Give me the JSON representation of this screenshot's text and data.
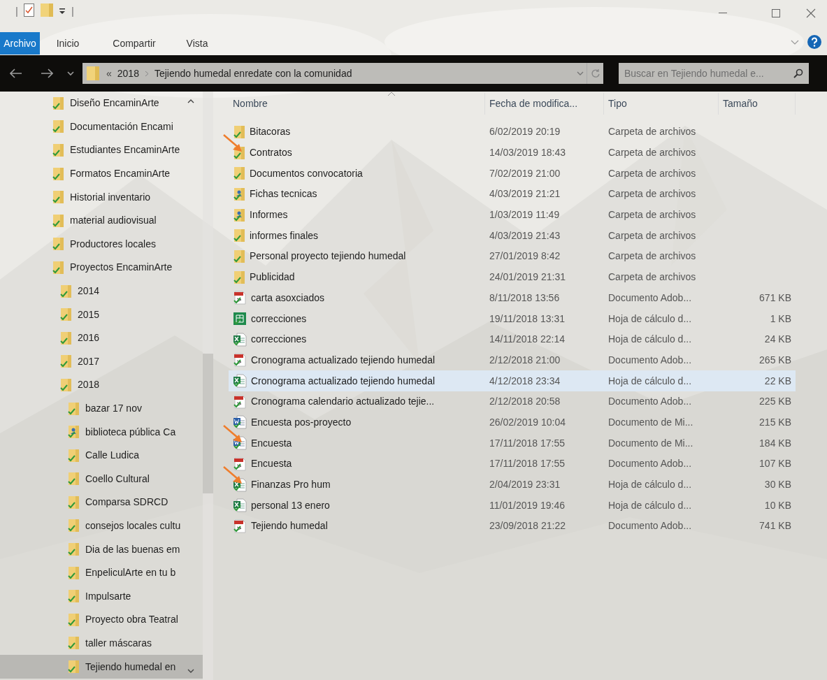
{
  "quick_access_toolbar": {
    "separator_left": "|",
    "separator_right": "|"
  },
  "ribbon_tabs": [
    {
      "label": "Archivo",
      "selected": true
    },
    {
      "label": "Inicio",
      "selected": false
    },
    {
      "label": "Compartir",
      "selected": false
    },
    {
      "label": "Vista",
      "selected": false
    }
  ],
  "address_bar": {
    "overflow": "«",
    "segments": [
      "2018",
      "Tejiendo humedal enredate con la comunidad"
    ]
  },
  "search": {
    "placeholder": "Buscar en Tejiendo humedal e..."
  },
  "sidebar": {
    "items": [
      {
        "label": "Diseño EncaminArte",
        "kind": "folder",
        "selected": false
      },
      {
        "label": "Documentación Encami",
        "kind": "folder",
        "selected": false
      },
      {
        "label": "Estudiantes EncaminArte",
        "kind": "folder",
        "selected": false
      },
      {
        "label": "Formatos EncaminArte",
        "kind": "folder",
        "selected": false
      },
      {
        "label": "Historial inventario",
        "kind": "folder",
        "selected": false
      },
      {
        "label": "material audiovisual",
        "kind": "folder",
        "selected": false
      },
      {
        "label": "Productores locales",
        "kind": "folder",
        "selected": false
      },
      {
        "label": "Proyectos EncaminArte",
        "kind": "folder",
        "selected": false,
        "children": [
          {
            "label": "2014",
            "kind": "folder",
            "selected": false
          },
          {
            "label": "2015",
            "kind": "folder",
            "selected": false
          },
          {
            "label": "2016",
            "kind": "folder",
            "selected": false
          },
          {
            "label": "2017",
            "kind": "folder",
            "selected": false
          },
          {
            "label": "2018",
            "kind": "folder",
            "selected": false,
            "children": [
              {
                "label": "bazar 17 nov",
                "kind": "folder",
                "selected": false
              },
              {
                "label": "biblioteca pública Ca",
                "kind": "shared-folder",
                "selected": false
              },
              {
                "label": "Calle Ludica",
                "kind": "folder",
                "selected": false
              },
              {
                "label": "Coello Cultural",
                "kind": "folder",
                "selected": false
              },
              {
                "label": "Comparsa SDRCD",
                "kind": "folder",
                "selected": false
              },
              {
                "label": "consejos locales cultu",
                "kind": "folder",
                "selected": false
              },
              {
                "label": "Dia de las buenas em",
                "kind": "folder",
                "selected": false
              },
              {
                "label": "EnpeliculArte en tu b",
                "kind": "folder",
                "selected": false
              },
              {
                "label": "Impulsarte",
                "kind": "folder",
                "selected": false
              },
              {
                "label": "Proyecto obra Teatral",
                "kind": "folder",
                "selected": false
              },
              {
                "label": "taller máscaras",
                "kind": "folder",
                "selected": false
              },
              {
                "label": "Tejiendo humedal en",
                "kind": "folder",
                "selected": true
              }
            ]
          }
        ]
      }
    ]
  },
  "table": {
    "columns": [
      "Nombre",
      "Fecha de modifica...",
      "Tipo",
      "Tamaño"
    ],
    "rows": [
      {
        "kind": "folder",
        "name": "Bitacoras",
        "date": "6/02/2019 20:19",
        "type": "Carpeta de archivos",
        "selected": false
      },
      {
        "kind": "folder",
        "name": "Contratos",
        "date": "14/03/2019 18:43",
        "type": "Carpeta de archivos",
        "selected": false,
        "annotated": true
      },
      {
        "kind": "folder",
        "name": "Documentos convocatoria",
        "date": "7/02/2019 21:00",
        "type": "Carpeta de archivos",
        "selected": false
      },
      {
        "kind": "shared-folder",
        "name": "Fichas tecnicas",
        "date": "4/03/2019 21:21",
        "type": "Carpeta de archivos",
        "selected": false
      },
      {
        "kind": "shared-folder",
        "name": "Informes",
        "date": "1/03/2019 11:49",
        "type": "Carpeta de archivos",
        "selected": false
      },
      {
        "kind": "folder",
        "name": "informes finales",
        "date": "4/03/2019 21:43",
        "type": "Carpeta de archivos",
        "selected": false
      },
      {
        "kind": "folder",
        "name": "Personal proyecto tejiendo humedal",
        "date": "27/01/2019 8:42",
        "type": "Carpeta de archivos",
        "selected": false
      },
      {
        "kind": "folder",
        "name": "Publicidad",
        "date": "24/01/2019 21:31",
        "type": "Carpeta de archivos",
        "selected": false
      },
      {
        "kind": "pdf",
        "name": "carta asoxciados",
        "date": "8/11/2018 13:56",
        "type": "Documento Adob...",
        "size": "671 KB",
        "selected": false
      },
      {
        "kind": "sheet",
        "name": "correcciones",
        "date": "19/11/2018 13:31",
        "type": "Hoja de cálculo d...",
        "size": "1 KB",
        "selected": false
      },
      {
        "kind": "excel",
        "name": "correcciones",
        "date": "14/11/2018 22:14",
        "type": "Hoja de cálculo d...",
        "size": "24 KB",
        "selected": false
      },
      {
        "kind": "pdf",
        "name": "Cronograma actualizado tejiendo humedal",
        "date": "2/12/2018 21:00",
        "type": "Documento Adob...",
        "size": "265 KB",
        "selected": false
      },
      {
        "kind": "excel",
        "name": "Cronograma actualizado tejiendo humedal",
        "date": "4/12/2018 23:34",
        "type": "Hoja de cálculo d...",
        "size": "22 KB",
        "selected": true
      },
      {
        "kind": "pdf",
        "name": "Cronograma calendario actualizado tejie...",
        "date": "2/12/2018 20:58",
        "type": "Documento Adob...",
        "size": "225 KB",
        "selected": false
      },
      {
        "kind": "word",
        "name": "Encuesta pos-proyecto",
        "date": "26/02/2019 10:04",
        "type": "Documento de Mi...",
        "size": "215 KB",
        "selected": false
      },
      {
        "kind": "word",
        "name": "Encuesta",
        "date": "17/11/2018 17:55",
        "type": "Documento de Mi...",
        "size": "184 KB",
        "selected": false,
        "annotated": true
      },
      {
        "kind": "pdf",
        "name": "Encuesta",
        "date": "17/11/2018 17:55",
        "type": "Documento Adob...",
        "size": "107 KB",
        "selected": false
      },
      {
        "kind": "excel",
        "name": "Finanzas Pro hum",
        "date": "2/04/2019 23:31",
        "type": "Hoja de cálculo d...",
        "size": "30 KB",
        "selected": false,
        "annotated": true
      },
      {
        "kind": "excel",
        "name": "personal 13 enero",
        "date": "11/01/2019 19:46",
        "type": "Hoja de cálculo d...",
        "size": "10 KB",
        "selected": false
      },
      {
        "kind": "pdf",
        "name": "Tejiendo humedal",
        "date": "23/09/2018 21:22",
        "type": "Documento Adob...",
        "size": "741 KB",
        "selected": false
      }
    ]
  }
}
